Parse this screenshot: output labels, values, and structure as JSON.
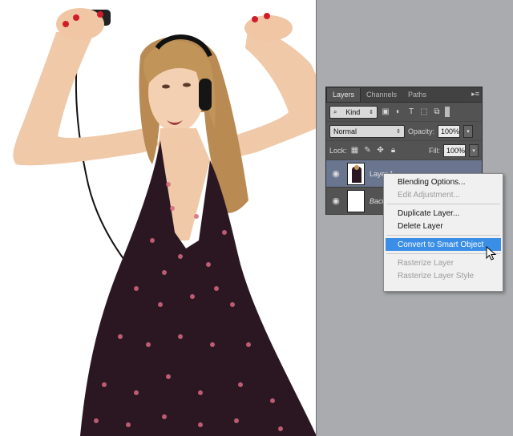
{
  "layers_panel": {
    "tabs": [
      "Layers",
      "Channels",
      "Paths"
    ],
    "active_tab": "Layers",
    "filter": {
      "label": "Kind"
    },
    "blend_mode": "Normal",
    "opacity_label": "Opacity:",
    "opacity_value": "100%",
    "lock_label": "Lock:",
    "fill_label": "Fill:",
    "fill_value": "100%",
    "layers": [
      {
        "name": "Layer 1",
        "selected": true,
        "visible": true
      },
      {
        "name": "Background",
        "selected": false,
        "visible": true
      }
    ]
  },
  "context_menu": {
    "items": [
      {
        "label": "Blending Options...",
        "enabled": true
      },
      {
        "label": "Edit Adjustment...",
        "enabled": false
      },
      {
        "label": "Duplicate Layer...",
        "enabled": true
      },
      {
        "label": "Delete Layer",
        "enabled": true
      },
      {
        "label": "Convert to Smart Object",
        "enabled": true,
        "highlighted": true
      },
      {
        "label": "Rasterize Layer",
        "enabled": false
      },
      {
        "label": "Rasterize Layer Style",
        "enabled": false
      }
    ]
  },
  "colors": {
    "workspace_bg": "#a9abae",
    "panel_bg": "#535353",
    "selected_layer": "#6a7590",
    "menu_highlight": "#3b8ee6"
  }
}
